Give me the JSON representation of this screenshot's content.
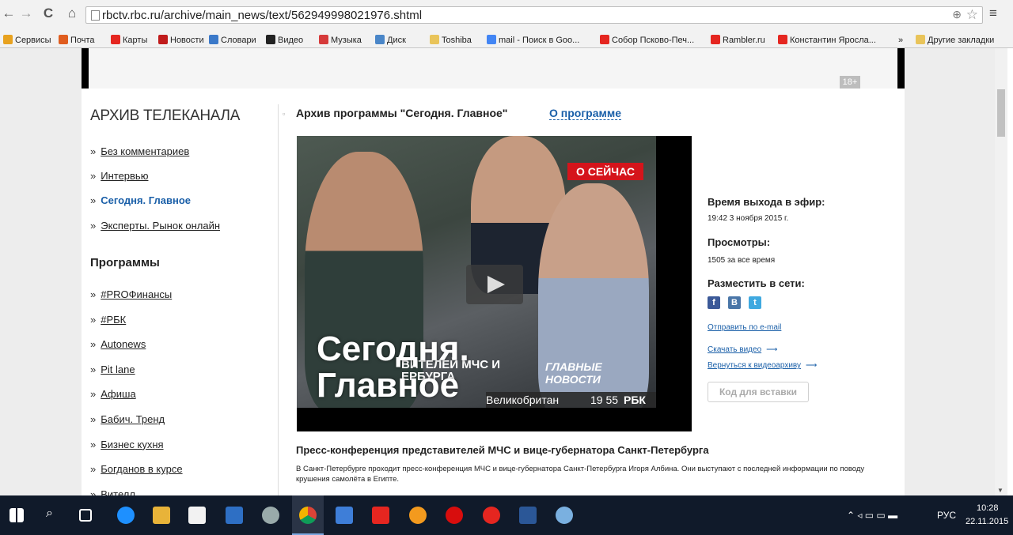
{
  "browser": {
    "url": "rbctv.rbc.ru/archive/main_news/text/562949998021976.shtml",
    "bookmarks": [
      {
        "label": "Сервисы",
        "color": "#e8a21f"
      },
      {
        "label": "Почта",
        "color": "#e05d1f"
      },
      {
        "label": "Карты",
        "color": "#e52620"
      },
      {
        "label": "Новости",
        "color": "#c01b1b"
      },
      {
        "label": "Словари",
        "color": "#3b79c9"
      },
      {
        "label": "Видео",
        "color": "#222222"
      },
      {
        "label": "Музыка",
        "color": "#d63a3a"
      },
      {
        "label": "Диск",
        "color": "#4a86c8"
      },
      {
        "label": "Toshiba",
        "color": "#e9c45a"
      },
      {
        "label": "mail - Поиск в Goo...",
        "color": "#4285f4"
      },
      {
        "label": "Собор Псково-Печ...",
        "color": "#e52620"
      },
      {
        "label": "Rambler.ru",
        "color": "#e52620"
      },
      {
        "label": "Константин Яросла...",
        "color": "#e52620"
      }
    ],
    "more": "»",
    "other_bookmarks": "Другие закладки"
  },
  "ad": {
    "age_badge": "18+"
  },
  "sidebar": {
    "title": "АРХИВ ТЕЛЕКАНАЛА",
    "channel_items": [
      {
        "label": "Без комментариев",
        "active": false
      },
      {
        "label": "Интервью",
        "active": false
      },
      {
        "label": "Сегодня. Главное",
        "active": true
      },
      {
        "label": "Эксперты. Рынок онлайн",
        "active": false
      }
    ],
    "programs_heading": "Программы",
    "program_items": [
      "#PROФинансы",
      "#РБК",
      "Autonews",
      "Pit lane",
      "Афиша",
      "Бабич. Тренд",
      "Бизнес кухня",
      "Богданов в курсе",
      "Вителл"
    ]
  },
  "main": {
    "archive_title": "Архив программы \"Сегодня. Главное\"",
    "about_link": "О программе",
    "video": {
      "live_badge": "О СЕЙЧАС",
      "title_line1": "Сегодня.",
      "title_line2": "Главное",
      "caption": "ВИТЕЛЕЙ МЧС И\nЕРБУРГА",
      "news_label": "ГЛАВНЫЕ\nНОВОСТИ",
      "ticker": "Великобритан",
      "ticker_time": "19 55",
      "channel_logo": "РБК"
    },
    "info": {
      "airtime_label": "Время выхода в эфир:",
      "airtime_value": "19:42 3 ноября 2015 г.",
      "views_label": "Просмотры:",
      "views_value": "1505 за все время",
      "share_label": "Разместить в сети:",
      "social": [
        {
          "name": "facebook-icon",
          "glyph": "f",
          "color": "#3b5998"
        },
        {
          "name": "vkontakte-icon",
          "glyph": "В",
          "color": "#4a76a8"
        },
        {
          "name": "twitter-icon",
          "glyph": "t",
          "color": "#3fa9e0"
        }
      ],
      "email_link": "Отправить по e-mail",
      "download_link": "Скачать видео",
      "back_link": "Вернуться к видеоархиву",
      "embed_button": "Код для вставки"
    },
    "story_title": "Пресс-конференция представителей МЧС и вице-губернатора Санкт-Петербурга",
    "story_text": "В Санкт-Петербурге проходит пресс-конференция МЧС и вице-губернатора Санкт-Петербурга Игоря Албина. Они выступают с последней информации по поводу крушения самолёта в Египте."
  },
  "taskbar": {
    "lang": "РУС",
    "time": "10:28",
    "date": "22.11.2015"
  }
}
